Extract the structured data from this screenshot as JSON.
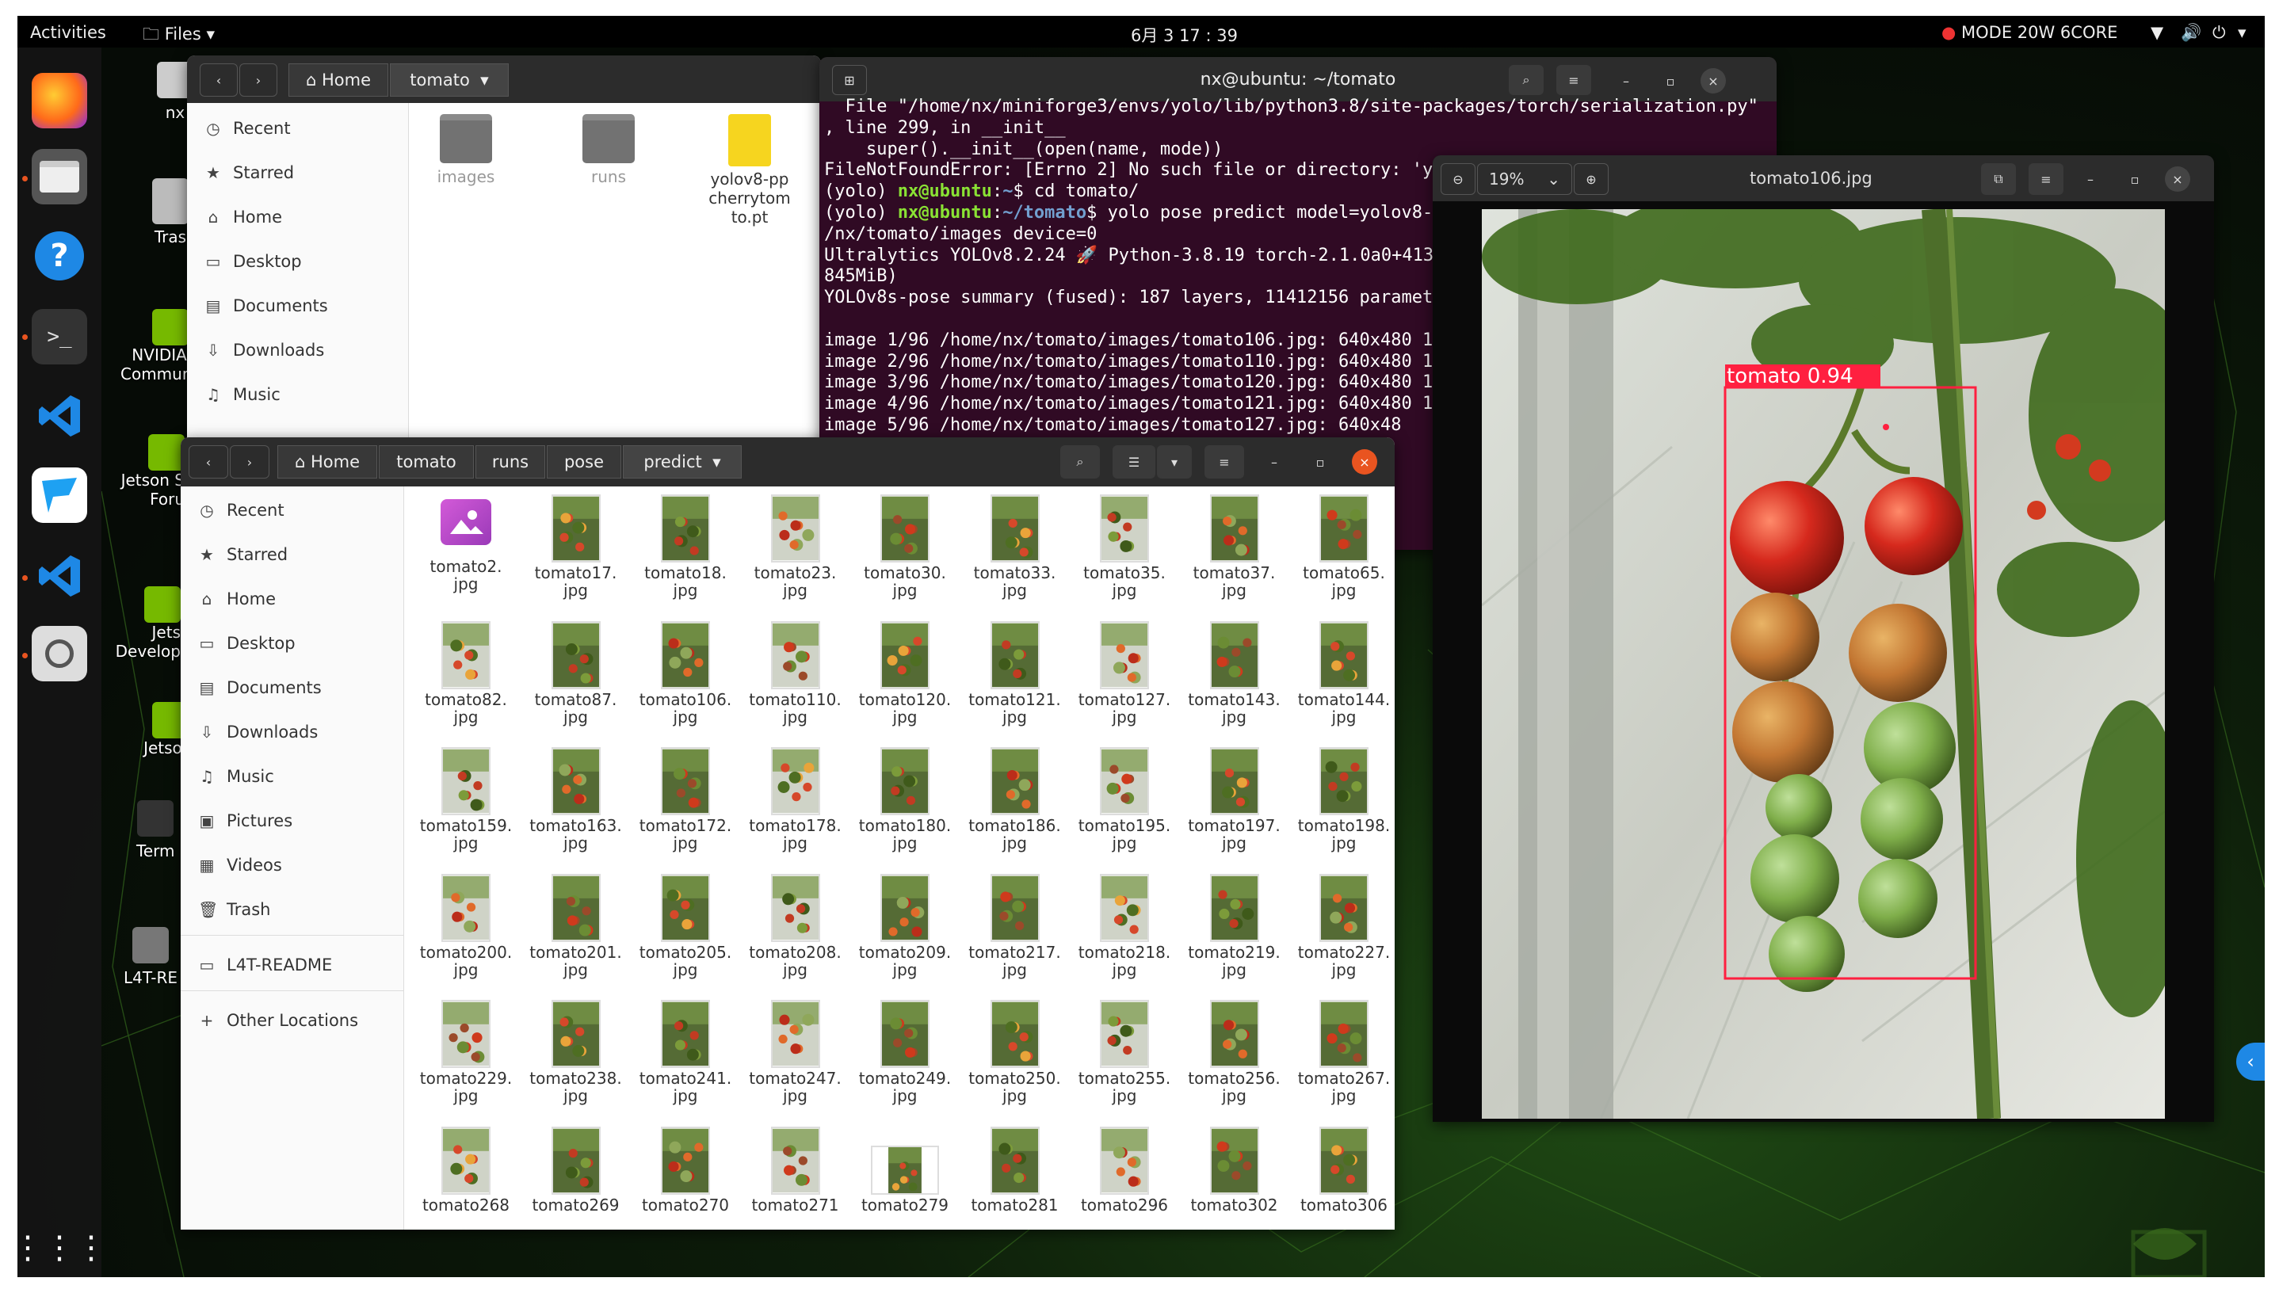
{
  "topbar": {
    "activities": "Activities",
    "app_menu": "Files",
    "clock": "6月 3 17 : 39",
    "power_mode": "MODE 20W 6CORE"
  },
  "desktop": {
    "icons": [
      "nx",
      "Tras",
      "NVIDIA J",
      "Communi",
      "Jetson S",
      "Foru",
      "Jets",
      "Develop",
      "Jetsor",
      "Term",
      "L4T-RE"
    ]
  },
  "files_back": {
    "path": [
      "Home",
      "tomato"
    ],
    "sidebar": [
      "Recent",
      "Starred",
      "Home",
      "Desktop",
      "Documents",
      "Downloads",
      "Music"
    ],
    "items": [
      {
        "name": "images"
      },
      {
        "name": "runs"
      },
      {
        "name": "yolov8-pp\ncherrytom\nto.pt"
      }
    ]
  },
  "terminal": {
    "title": "nx@ubuntu: ~/tomato",
    "lines": [
      "  File \"/home/nx/miniforge3/envs/yolo/lib/python3.8/site-packages/torch/serialization.py\"",
      ", line 299, in __init__",
      "    super().__init__(open(name, mode))",
      "FileNotFoundError: [Errno 2] No such file or directory: 'y",
      "(yolo) nx@ubuntu:~$ cd tomato/",
      "(yolo) nx@ubuntu:~/tomato$ yolo pose predict model=yolov8-",
      "/nx/tomato/images device=0",
      "Ultralytics YOLOv8.2.24 🚀 Python-3.8.19 torch-2.1.0a0+413",
      "845MiB)",
      "YOLOv8s-pose summary (fused): 187 layers, 11412156 paramet",
      "",
      "image 1/96 /home/nx/tomato/images/tomato106.jpg: 640x480 1",
      "image 2/96 /home/nx/tomato/images/tomato110.jpg: 640x480 1",
      "image 3/96 /home/nx/tomato/images/tomato120.jpg: 640x480 1",
      "image 4/96 /home/nx/tomato/images/tomato121.jpg: 640x480 1",
      "image 5/96 /home/nx/tomato/images/tomato127.jpg: 640x48"
    ],
    "right_col": [
      "1",
      "1",
      "1",
      "1"
    ]
  },
  "viewer": {
    "zoom": "19%",
    "title": "tomato106.jpg",
    "detection_label": "tomato 0.94"
  },
  "files_front": {
    "path": [
      "Home",
      "tomato",
      "runs",
      "pose",
      "predict"
    ],
    "sidebar": [
      "Recent",
      "Starred",
      "Home",
      "Desktop",
      "Documents",
      "Downloads",
      "Music",
      "Pictures",
      "Videos",
      "Trash",
      "L4T-README",
      "Other Locations"
    ],
    "files": [
      "tomato2.",
      "tomato17.",
      "tomato18.",
      "tomato23.",
      "tomato30.",
      "tomato33.",
      "tomato35.",
      "tomato37.",
      "tomato65.",
      "tomato82.",
      "tomato87.",
      "tomato106.",
      "tomato110.",
      "tomato120.",
      "tomato121.",
      "tomato127.",
      "tomato143.",
      "tomato144.",
      "tomato159.",
      "tomato163.",
      "tomato172.",
      "tomato178.",
      "tomato180.",
      "tomato186.",
      "tomato195.",
      "tomato197.",
      "tomato198.",
      "tomato200.",
      "tomato201.",
      "tomato205.",
      "tomato208.",
      "tomato209.",
      "tomato217.",
      "tomato218.",
      "tomato219.",
      "tomato227.",
      "tomato229.",
      "tomato238.",
      "tomato241.",
      "tomato247.",
      "tomato249.",
      "tomato250.",
      "tomato255.",
      "tomato256.",
      "tomato267.",
      "tomato268",
      "tomato269",
      "tomato270",
      "tomato271",
      "tomato279",
      "tomato281",
      "tomato296",
      "tomato302",
      "tomato306"
    ],
    "ext": "jpg"
  },
  "colors": {
    "accent": "#e95420",
    "terminal_bg": "#300a24",
    "detection": "#ff2040"
  }
}
